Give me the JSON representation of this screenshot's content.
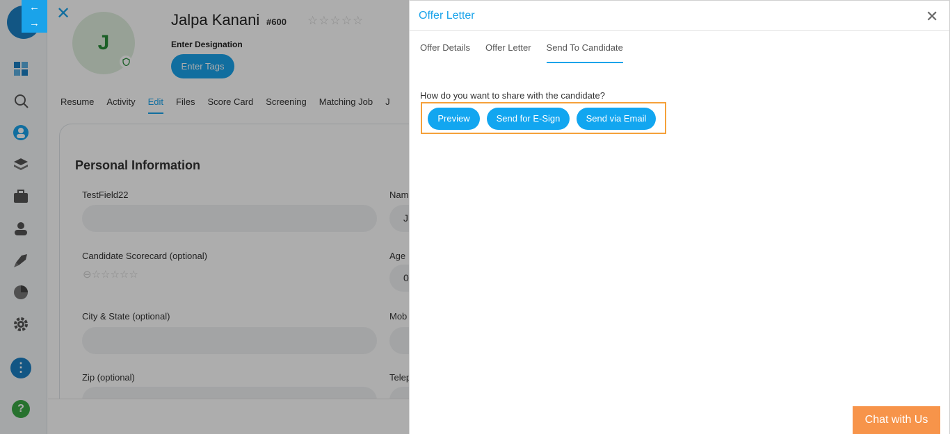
{
  "candidate": {
    "initial": "J",
    "name": "Jalpa Kanani",
    "id": "#600",
    "rating_stars": "☆☆☆☆☆",
    "designation_placeholder": "Enter Designation",
    "tags_button": "Enter Tags"
  },
  "candidate_tabs": [
    {
      "label": "Resume",
      "active": false
    },
    {
      "label": "Activity",
      "active": false
    },
    {
      "label": "Edit",
      "active": true
    },
    {
      "label": "Files",
      "active": false
    },
    {
      "label": "Score Card",
      "active": false
    },
    {
      "label": "Screening",
      "active": false
    },
    {
      "label": "Matching Job",
      "active": false
    },
    {
      "label": "J",
      "active": false
    }
  ],
  "form": {
    "section_title": "Personal Information",
    "fields": [
      {
        "label": "TestField22",
        "value": ""
      },
      {
        "label": "Nam",
        "value": "J"
      },
      {
        "label": "Candidate Scorecard (optional)",
        "value": "☆☆☆☆☆"
      },
      {
        "label": "Age",
        "value": "0"
      },
      {
        "label": "City & State (optional)",
        "value": ""
      },
      {
        "label": "Mob",
        "value": ""
      },
      {
        "label": "Zip (optional)",
        "value": ""
      },
      {
        "label": "Telep",
        "value": ""
      }
    ]
  },
  "panel": {
    "title": "Offer Letter",
    "tabs": [
      {
        "label": "Offer Details",
        "active": false
      },
      {
        "label": "Offer Letter",
        "active": false
      },
      {
        "label": "Send To Candidate",
        "active": true
      }
    ],
    "question": "How do you want to share with the candidate?",
    "buttons": {
      "preview": "Preview",
      "esign": "Send for E-Sign",
      "email": "Send via Email"
    }
  },
  "chat": {
    "label": "Chat with Us"
  },
  "colors": {
    "accent": "#1aa3ea",
    "highlight_border": "#f5a13a",
    "chat": "#f7944a"
  }
}
